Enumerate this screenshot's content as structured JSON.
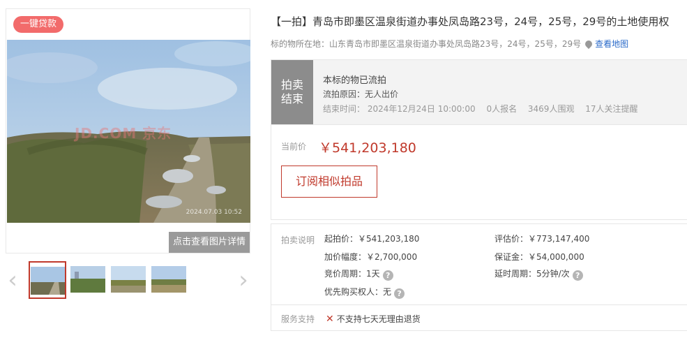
{
  "gallery": {
    "loan_badge": "一键贷款",
    "watermark": "JD.COM 京东",
    "timestamp": "2024.07.03  10:52",
    "detail_button": "点击查看图片详情",
    "prev_arrow": "‹",
    "next_arrow": "›"
  },
  "title": "【一拍】青岛市即墨区温泉街道办事处凤岛路23号，24号，25号，29号的土地使用权",
  "location": {
    "label": "标的物所在地：",
    "address": "山东青岛市即墨区温泉街道办事处凤岛路23号，24号，25号，29号",
    "map_link": "查看地图"
  },
  "status": {
    "tag_line1": "拍卖",
    "tag_line2": "结束",
    "headline": "本标的物已流拍",
    "reason": "流拍原因：无人出价",
    "end_time": "结束时间： 2024年12月24日 10:00:00",
    "signups": "0人报名",
    "views": "3469人围观",
    "followers": "17人关注提醒"
  },
  "price": {
    "label": "当前价",
    "value": "￥541,203,180",
    "subscribe_button": "订阅相似拍品"
  },
  "auction_info": {
    "title": "拍卖说明",
    "start_price": "起拍价：￥541,203,180",
    "appraisal": "评估价：￥773,147,400",
    "increment": "加价幅度：￥2,700,000",
    "deposit": "保证金：￥54,000,000",
    "bid_period": "竞价周期：1天",
    "extension": "延时周期：5分钟/次",
    "priority": "优先购买权人：无",
    "help_glyph": "?"
  },
  "service": {
    "title": "服务支持",
    "item": "不支持七天无理由退货",
    "icon": "✕"
  },
  "colors": {
    "accent": "#c0392b",
    "badge": "#f26b6b",
    "status_tag": "#8c8c8c",
    "link": "#2a6ac9"
  }
}
